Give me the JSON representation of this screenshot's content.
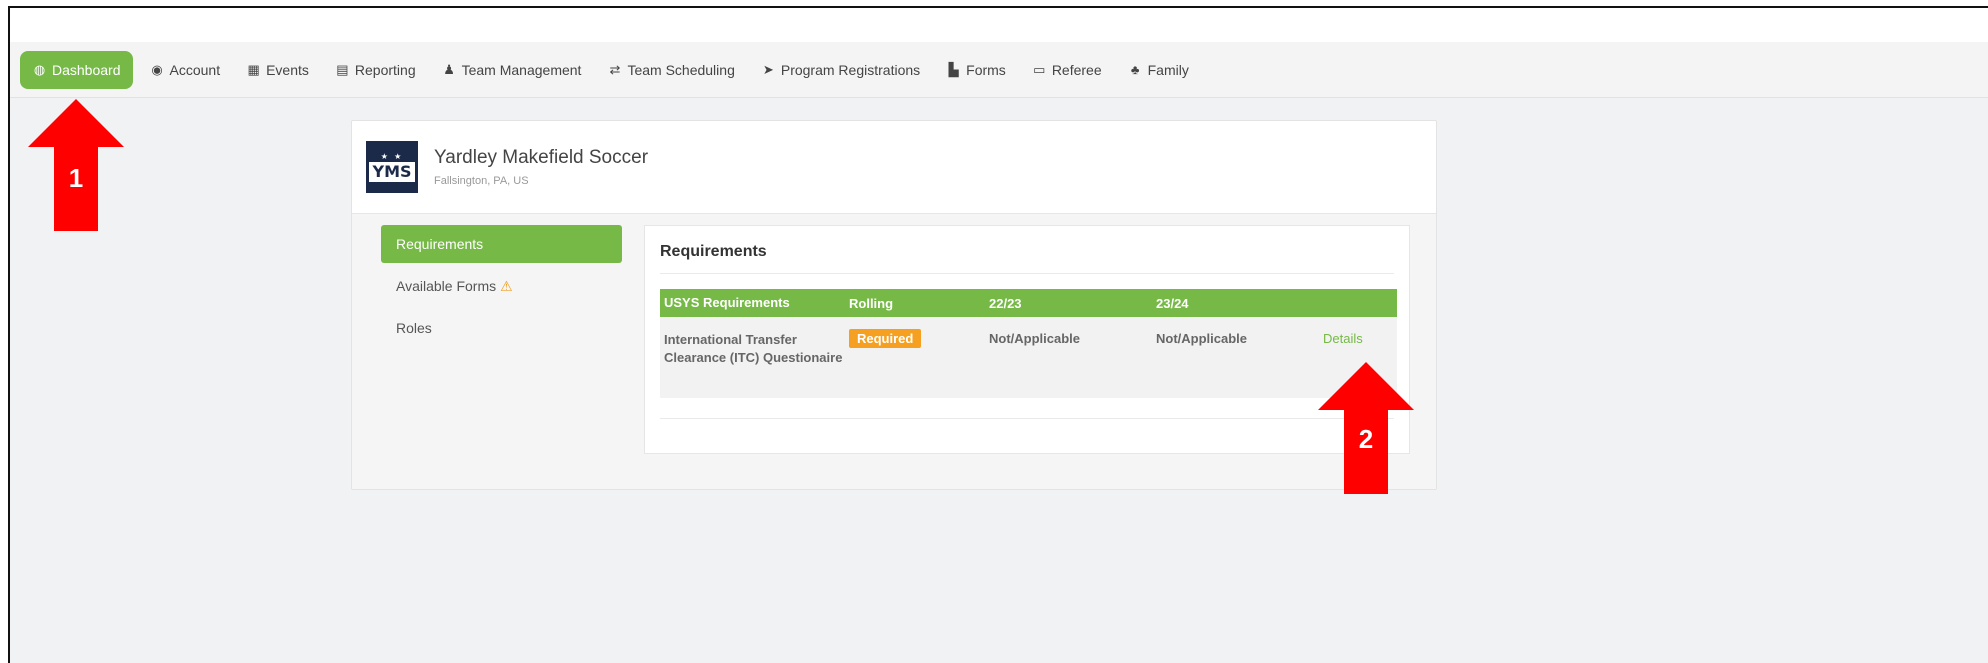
{
  "nav": {
    "items": [
      {
        "label": "Dashboard",
        "icon": "dashboard-icon",
        "glyph": "◍",
        "active": true
      },
      {
        "label": "Account",
        "icon": "user-circle-icon",
        "glyph": "◉",
        "active": false
      },
      {
        "label": "Events",
        "icon": "calendar-icon",
        "glyph": "▦",
        "active": false
      },
      {
        "label": "Reporting",
        "icon": "document-icon",
        "glyph": "▤",
        "active": false
      },
      {
        "label": "Team Management",
        "icon": "users-icon",
        "glyph": "♟",
        "active": false
      },
      {
        "label": "Team Scheduling",
        "icon": "exchange-icon",
        "glyph": "⇄",
        "active": false
      },
      {
        "label": "Program Registrations",
        "icon": "send-icon",
        "glyph": "➤",
        "active": false
      },
      {
        "label": "Forms",
        "icon": "file-icon",
        "glyph": "▙",
        "active": false
      },
      {
        "label": "Referee",
        "icon": "calendar-outline-icon",
        "glyph": "▭",
        "active": false
      },
      {
        "label": "Family",
        "icon": "sitemap-icon",
        "glyph": "♣",
        "active": false
      }
    ]
  },
  "org": {
    "logo_text": "YMS",
    "logo_stars": "★ ★",
    "name": "Yardley Makefield Soccer",
    "location": "Fallsington, PA, US"
  },
  "sidebar": {
    "items": [
      {
        "label": "Requirements",
        "active": true
      },
      {
        "label": "Available Forms",
        "warning": "⚠",
        "active": false
      },
      {
        "label": "Roles",
        "active": false
      }
    ]
  },
  "requirements": {
    "title": "Requirements",
    "columns": [
      "USYS Requirements",
      "Rolling",
      "22/23",
      "23/24",
      ""
    ],
    "rows": [
      {
        "name": "International Transfer Clearance (ITC) Questionaire",
        "rolling": "Required",
        "y2223": "Not/Applicable",
        "y2324": "Not/Applicable",
        "action": "Details"
      }
    ]
  },
  "annotations": {
    "arrow1_label": "1",
    "arrow2_label": "2",
    "arrow_color": "#ff0000"
  },
  "colors": {
    "accent_green": "#76b947",
    "badge_orange": "#f5a020",
    "logo_navy": "#1c2a4a"
  }
}
